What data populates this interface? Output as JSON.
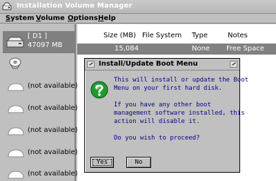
{
  "window": {
    "title": "Installation Volume Manager"
  },
  "menu": [
    {
      "label": "System",
      "accel": "S"
    },
    {
      "label": "Volume",
      "accel": "V"
    },
    {
      "label": "Options",
      "accel": "O"
    },
    {
      "label": "Help",
      "accel": "H"
    }
  ],
  "volumes": {
    "selected": {
      "name": "[ D1 ]",
      "size": "47097 MB"
    },
    "items": [
      {
        "label": "(not available)"
      },
      {
        "label": "(not available)"
      },
      {
        "label": "(not available)"
      },
      {
        "label": "(not available)"
      },
      {
        "label": "(not available)"
      }
    ]
  },
  "table": {
    "columns": [
      "Size (MB)",
      "File System",
      "Type",
      "Notes"
    ],
    "rows": [
      {
        "size": "15,084",
        "fs": "",
        "type": "None",
        "notes": "Free Space"
      }
    ]
  },
  "dialog": {
    "title": "Install/Update Boot Menu",
    "lines": [
      "This will install or update the Boot",
      "Menu on your first hard disk.",
      "If you have any other boot",
      "management software installed, this",
      "action will disable it.",
      "Do you wish to proceed?"
    ],
    "yes_label": "Yes",
    "no_label": "No"
  }
}
